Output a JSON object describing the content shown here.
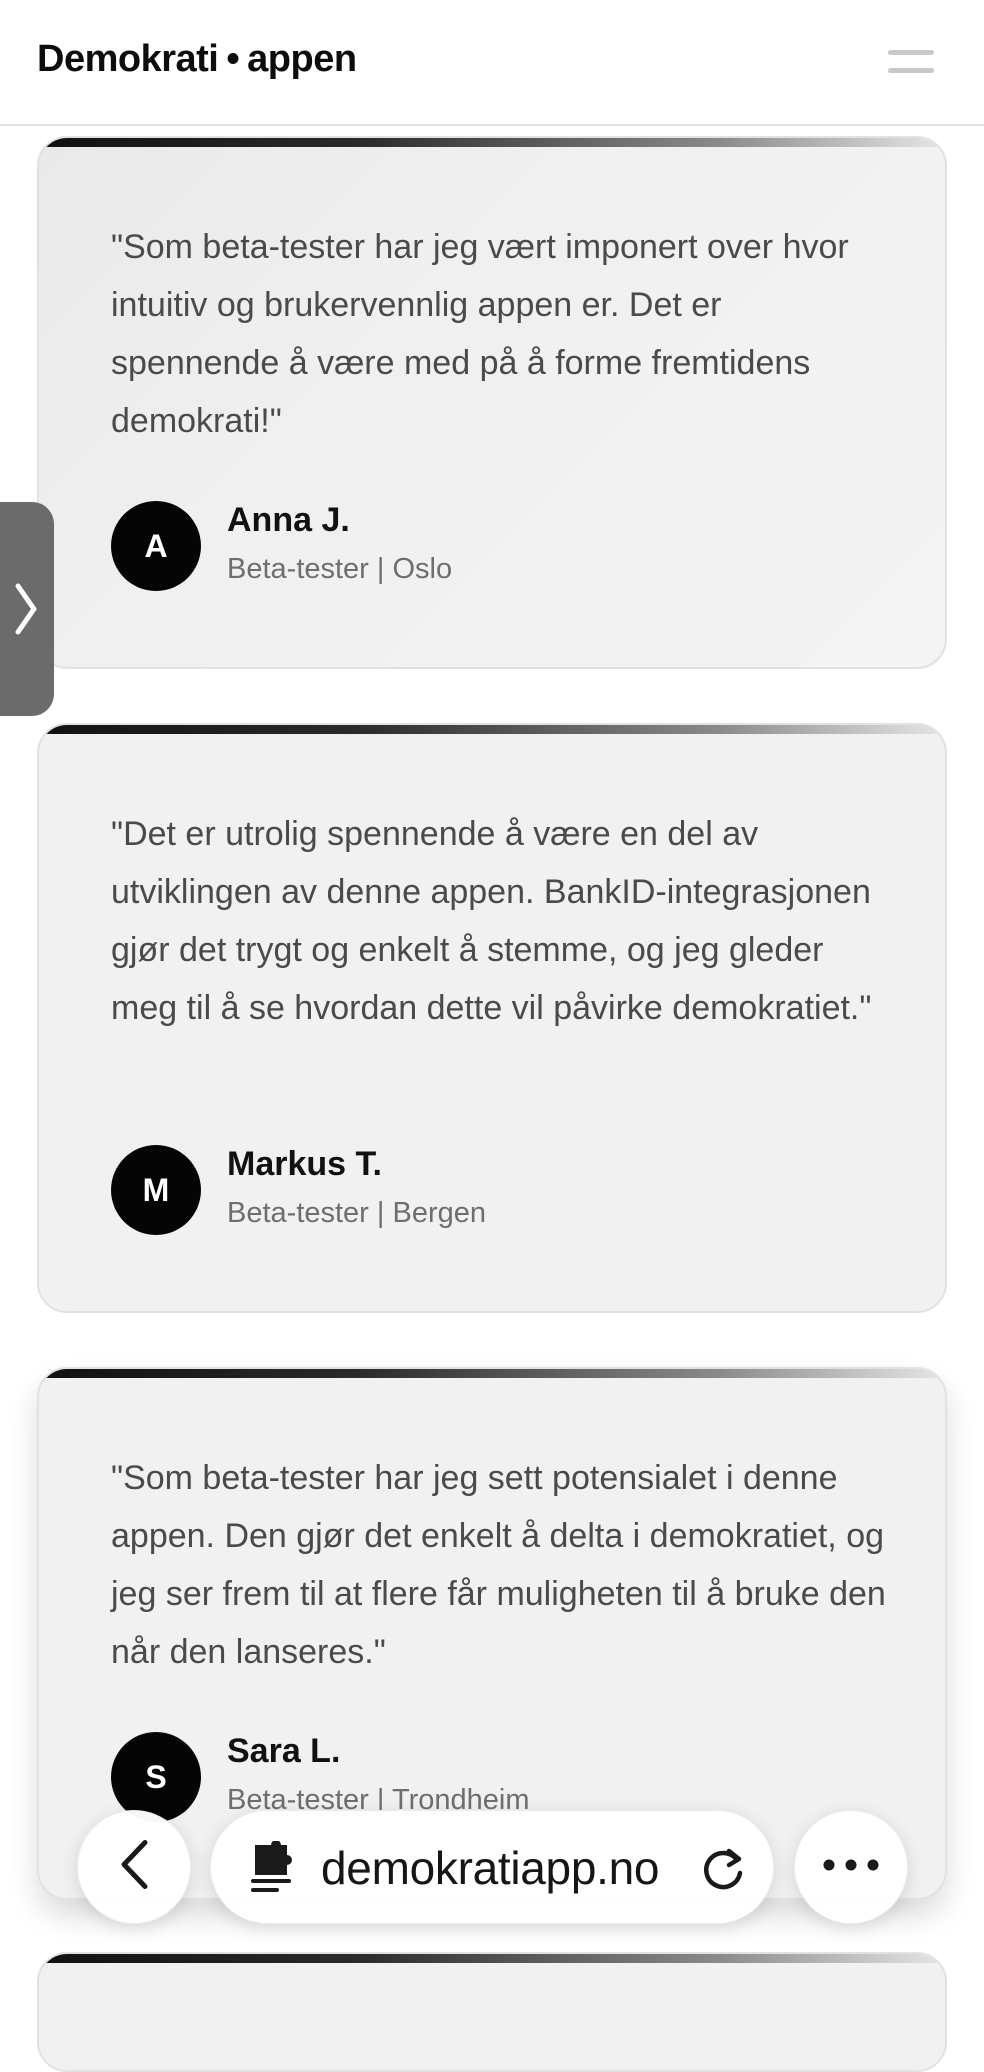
{
  "header": {
    "brand_left": "Demokrati",
    "brand_dot": "•",
    "brand_right": "appen"
  },
  "testimonials": [
    {
      "quote": "\"Som beta-tester har jeg vært imponert over hvor intuitiv og brukervennlig appen er. Det er spennende å være med på å forme fremtidens demokrati!\"",
      "initial": "A",
      "name": "Anna J.",
      "role": "Beta-tester | Oslo"
    },
    {
      "quote": "\"Det er utrolig spennende å være en del av utviklingen av denne appen. BankID-integrasjonen gjør det trygt og enkelt å stemme, og jeg gleder meg til å se hvordan dette vil påvirke demokratiet.\"",
      "initial": "M",
      "name": "Markus T.",
      "role": "Beta-tester | Bergen"
    },
    {
      "quote": "\"Som beta-tester har jeg sett potensialet i denne appen. Den gjør det enkelt å delta i demokratiet, og jeg ser frem til at flere får muligheten til å bruke den når den lanseres.\"",
      "initial": "S",
      "name": "Sara L.",
      "role": "Beta-tester | Trondheim"
    }
  ],
  "browser": {
    "url": "demokratiapp.no",
    "icons": {
      "back": "chevron-left-icon",
      "reader": "reader-mode-icon",
      "reload": "reload-icon",
      "more": "more-dots-icon",
      "side_tab": "chevron-right-icon",
      "menu": "hamburger-menu-icon"
    }
  },
  "colors": {
    "card_bg": "#f1f1f1",
    "avatar_bg": "#050505",
    "quote_text": "#4a4a4a",
    "role_text": "#6e6e6e",
    "side_tab": "#6b6b6b"
  }
}
